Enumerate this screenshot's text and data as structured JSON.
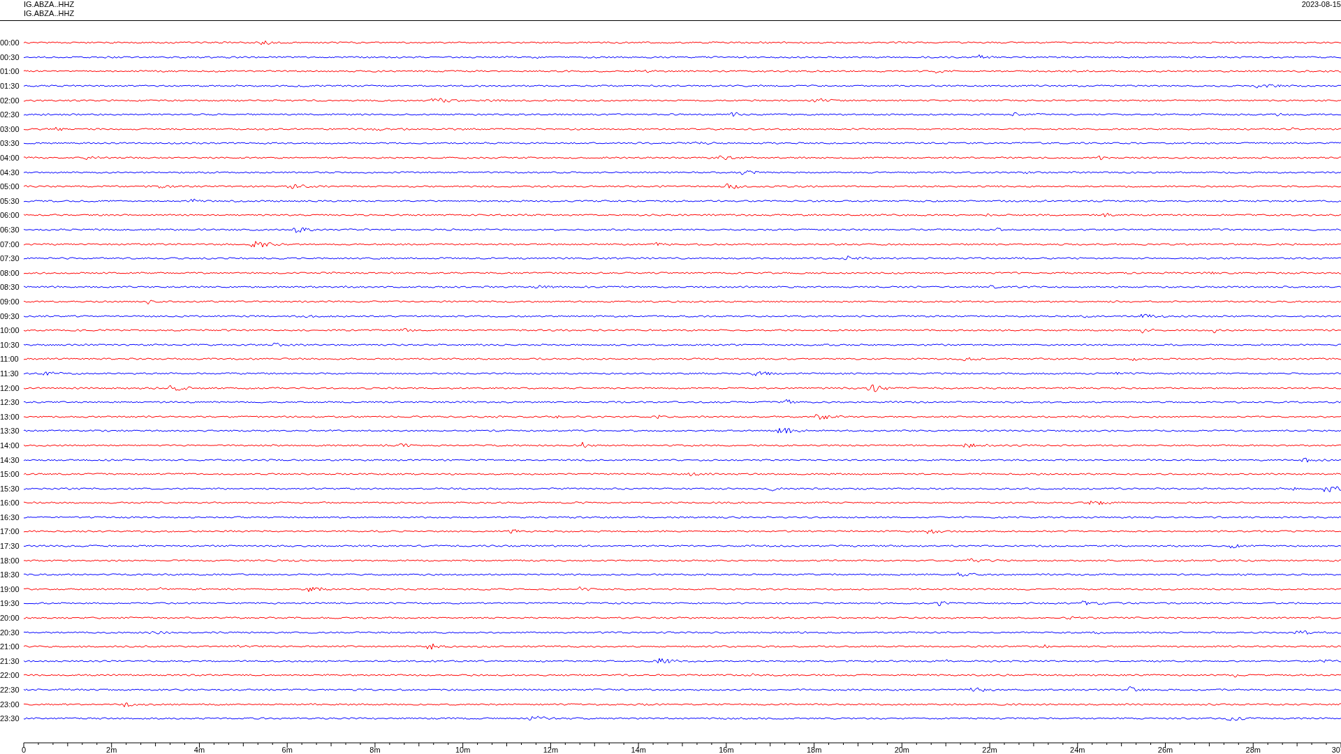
{
  "header": {
    "station_lines": [
      "IG.ABZA..HHZ",
      "IG.ABZA..HHZ"
    ],
    "date": "2023-08-15"
  },
  "rows": [
    {
      "label": "00:00",
      "color": "#ff0000"
    },
    {
      "label": "00:30",
      "color": "#0000ff"
    },
    {
      "label": "01:00",
      "color": "#ff0000"
    },
    {
      "label": "01:30",
      "color": "#0000ff"
    },
    {
      "label": "02:00",
      "color": "#ff0000"
    },
    {
      "label": "02:30",
      "color": "#0000ff"
    },
    {
      "label": "03:00",
      "color": "#ff0000"
    },
    {
      "label": "03:30",
      "color": "#0000ff"
    },
    {
      "label": "04:00",
      "color": "#ff0000"
    },
    {
      "label": "04:30",
      "color": "#0000ff"
    },
    {
      "label": "05:00",
      "color": "#ff0000"
    },
    {
      "label": "05:30",
      "color": "#0000ff"
    },
    {
      "label": "06:00",
      "color": "#ff0000"
    },
    {
      "label": "06:30",
      "color": "#0000ff"
    },
    {
      "label": "07:00",
      "color": "#ff0000"
    },
    {
      "label": "07:30",
      "color": "#0000ff"
    },
    {
      "label": "08:00",
      "color": "#ff0000"
    },
    {
      "label": "08:30",
      "color": "#0000ff"
    },
    {
      "label": "09:00",
      "color": "#ff0000"
    },
    {
      "label": "09:30",
      "color": "#0000ff"
    },
    {
      "label": "10:00",
      "color": "#ff0000"
    },
    {
      "label": "10:30",
      "color": "#0000ff"
    },
    {
      "label": "11:00",
      "color": "#ff0000"
    },
    {
      "label": "11:30",
      "color": "#0000ff"
    },
    {
      "label": "12:00",
      "color": "#ff0000"
    },
    {
      "label": "12:30",
      "color": "#0000ff"
    },
    {
      "label": "13:00",
      "color": "#ff0000"
    },
    {
      "label": "13:30",
      "color": "#0000ff"
    },
    {
      "label": "14:00",
      "color": "#ff0000"
    },
    {
      "label": "14:30",
      "color": "#0000ff"
    },
    {
      "label": "15:00",
      "color": "#ff0000"
    },
    {
      "label": "15:30",
      "color": "#0000ff"
    },
    {
      "label": "16:00",
      "color": "#ff0000"
    },
    {
      "label": "16:30",
      "color": "#0000ff"
    },
    {
      "label": "17:00",
      "color": "#ff0000"
    },
    {
      "label": "17:30",
      "color": "#0000ff"
    },
    {
      "label": "18:00",
      "color": "#ff0000"
    },
    {
      "label": "18:30",
      "color": "#0000ff"
    },
    {
      "label": "19:00",
      "color": "#ff0000"
    },
    {
      "label": "19:30",
      "color": "#0000ff"
    },
    {
      "label": "20:00",
      "color": "#ff0000"
    },
    {
      "label": "20:30",
      "color": "#0000ff"
    },
    {
      "label": "21:00",
      "color": "#ff0000"
    },
    {
      "label": "21:30",
      "color": "#0000ff"
    },
    {
      "label": "22:00",
      "color": "#ff0000"
    },
    {
      "label": "22:30",
      "color": "#0000ff"
    },
    {
      "label": "23:00",
      "color": "#ff0000"
    },
    {
      "label": "23:30",
      "color": "#0000ff"
    }
  ],
  "x_axis": {
    "tick_labels": [
      "0",
      "2m",
      "4m",
      "6m",
      "8m",
      "10m",
      "12m",
      "14m",
      "16m",
      "18m",
      "20m",
      "22m",
      "24m",
      "26m",
      "28m",
      "30"
    ]
  }
}
